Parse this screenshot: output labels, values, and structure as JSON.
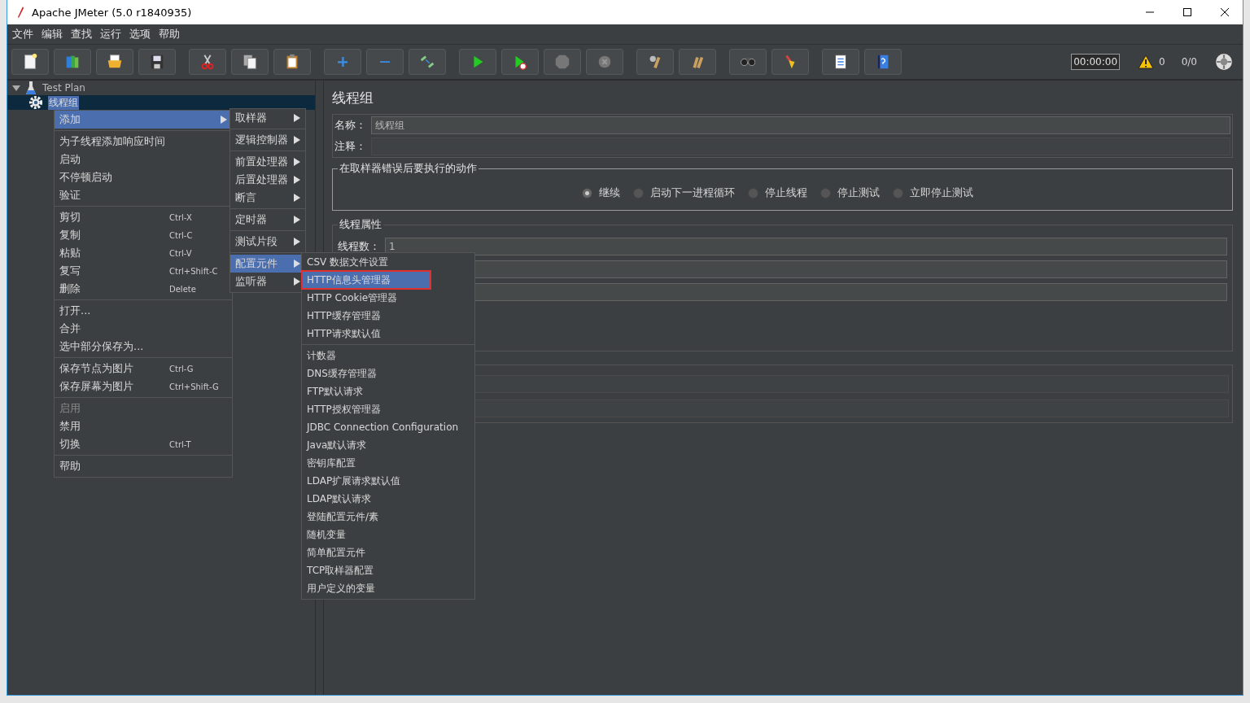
{
  "window": {
    "title": "Apache JMeter (5.0 r1840935)"
  },
  "menubar": [
    "文件",
    "编辑",
    "查找",
    "运行",
    "选项",
    "帮助"
  ],
  "toolbar": {
    "groups": [
      [
        {
          "kind": "new"
        },
        {
          "kind": "templates"
        },
        {
          "kind": "open"
        },
        {
          "kind": "save"
        }
      ],
      [
        {
          "kind": "cut"
        },
        {
          "kind": "copy"
        },
        {
          "kind": "paste"
        }
      ],
      [
        {
          "kind": "expand"
        },
        {
          "kind": "collapse"
        },
        {
          "kind": "toggle"
        }
      ],
      [
        {
          "kind": "start"
        },
        {
          "kind": "start_no_pause"
        },
        {
          "kind": "stop"
        },
        {
          "kind": "shutdown"
        }
      ],
      [
        {
          "kind": "clear"
        },
        {
          "kind": "clear_all"
        }
      ],
      [
        {
          "kind": "search"
        },
        {
          "kind": "reset_search"
        }
      ],
      [
        {
          "kind": "function_helper"
        },
        {
          "kind": "help"
        }
      ]
    ],
    "timer": "00:00:00",
    "warnings": "0",
    "threads": "0/0"
  },
  "tree": [
    {
      "label": "Test Plan",
      "expanded": true,
      "selected": false,
      "children": [
        {
          "label": "线程组",
          "selected": true
        }
      ]
    }
  ],
  "context_menu": [
    [
      {
        "label": "添加",
        "submenu": true,
        "selected": true,
        "disabled": false
      }
    ],
    [
      {
        "label": "为子线程添加响应时间",
        "selected": false,
        "disabled": false
      },
      {
        "label": "启动",
        "selected": false,
        "disabled": false
      },
      {
        "label": "不停顿启动",
        "selected": false,
        "disabled": false
      },
      {
        "label": "验证",
        "selected": false,
        "disabled": false
      }
    ],
    [
      {
        "label": "剪切",
        "shortcut": "Ctrl-X",
        "selected": false,
        "disabled": false
      },
      {
        "label": "复制",
        "shortcut": "Ctrl-C",
        "selected": false,
        "disabled": false
      },
      {
        "label": "粘贴",
        "shortcut": "Ctrl-V",
        "selected": false,
        "disabled": false
      },
      {
        "label": "复写",
        "shortcut": "Ctrl+Shift-C",
        "selected": false,
        "disabled": false
      },
      {
        "label": "删除",
        "shortcut": "Delete",
        "selected": false,
        "disabled": false
      }
    ],
    [
      {
        "label": "打开...",
        "selected": false,
        "disabled": false
      },
      {
        "label": "合并",
        "selected": false,
        "disabled": false
      },
      {
        "label": "选中部分保存为...",
        "selected": false,
        "disabled": false
      }
    ],
    [
      {
        "label": "保存节点为图片",
        "shortcut": "Ctrl-G",
        "selected": false,
        "disabled": false
      },
      {
        "label": "保存屏幕为图片",
        "shortcut": "Ctrl+Shift-G",
        "selected": false,
        "disabled": false
      }
    ],
    [
      {
        "label": "启用",
        "selected": false,
        "disabled": true
      },
      {
        "label": "禁用",
        "selected": false,
        "disabled": false
      },
      {
        "label": "切换",
        "shortcut": "Ctrl-T",
        "selected": false,
        "disabled": false
      }
    ],
    [
      {
        "label": "帮助",
        "selected": false,
        "disabled": false
      }
    ]
  ],
  "add_submenu": [
    [
      {
        "label": "取样器",
        "selected": false
      }
    ],
    [
      {
        "label": "逻辑控制器",
        "selected": false
      }
    ],
    [
      {
        "label": "前置处理器",
        "selected": false
      },
      {
        "label": "后置处理器",
        "selected": false
      },
      {
        "label": "断言",
        "selected": false
      }
    ],
    [
      {
        "label": "定时器",
        "selected": false
      }
    ],
    [
      {
        "label": "测试片段",
        "selected": false
      }
    ],
    [
      {
        "label": "配置元件",
        "selected": true
      },
      {
        "label": "监听器",
        "selected": false
      }
    ]
  ],
  "config_submenu": [
    [
      {
        "label": "CSV 数据文件设置",
        "selected": false,
        "outlined": false
      },
      {
        "label": "HTTP信息头管理器",
        "selected": true,
        "outlined": true
      },
      {
        "label": "HTTP Cookie管理器",
        "selected": false,
        "outlined": false
      },
      {
        "label": "HTTP缓存管理器",
        "selected": false,
        "outlined": false
      },
      {
        "label": "HTTP请求默认值",
        "selected": false,
        "outlined": false
      }
    ],
    [
      {
        "label": "计数器",
        "selected": false,
        "outlined": false
      },
      {
        "label": "DNS缓存管理器",
        "selected": false,
        "outlined": false
      },
      {
        "label": "FTP默认请求",
        "selected": false,
        "outlined": false
      },
      {
        "label": "HTTP授权管理器",
        "selected": false,
        "outlined": false
      },
      {
        "label": "JDBC Connection Configuration",
        "selected": false,
        "outlined": false
      },
      {
        "label": "Java默认请求",
        "selected": false,
        "outlined": false
      },
      {
        "label": "密钥库配置",
        "selected": false,
        "outlined": false
      },
      {
        "label": "LDAP扩展请求默认值",
        "selected": false,
        "outlined": false
      },
      {
        "label": "LDAP默认请求",
        "selected": false,
        "outlined": false
      },
      {
        "label": "登陆配置元件/素",
        "selected": false,
        "outlined": false
      },
      {
        "label": "随机变量",
        "selected": false,
        "outlined": false
      },
      {
        "label": "简单配置元件",
        "selected": false,
        "outlined": false
      },
      {
        "label": "TCP取样器配置",
        "selected": false,
        "outlined": false
      },
      {
        "label": "用户定义的变量",
        "selected": false,
        "outlined": false
      }
    ]
  ],
  "panel": {
    "title": "线程组",
    "name_label": "名称：",
    "name_value": "线程组",
    "comment_label": "注释：",
    "error_action": {
      "legend": "在取样器错误后要执行的动作",
      "options": [
        {
          "label": "继续",
          "selected": true
        },
        {
          "label": "启动下一进程循环",
          "selected": false
        },
        {
          "label": "停止线程",
          "selected": false
        },
        {
          "label": "停止测试",
          "selected": false
        },
        {
          "label": "立即停止测试",
          "selected": false
        }
      ]
    },
    "thread_props": {
      "legend": "线程属性",
      "thread_count_label": "线程数：",
      "thread_count_value": "1"
    }
  }
}
